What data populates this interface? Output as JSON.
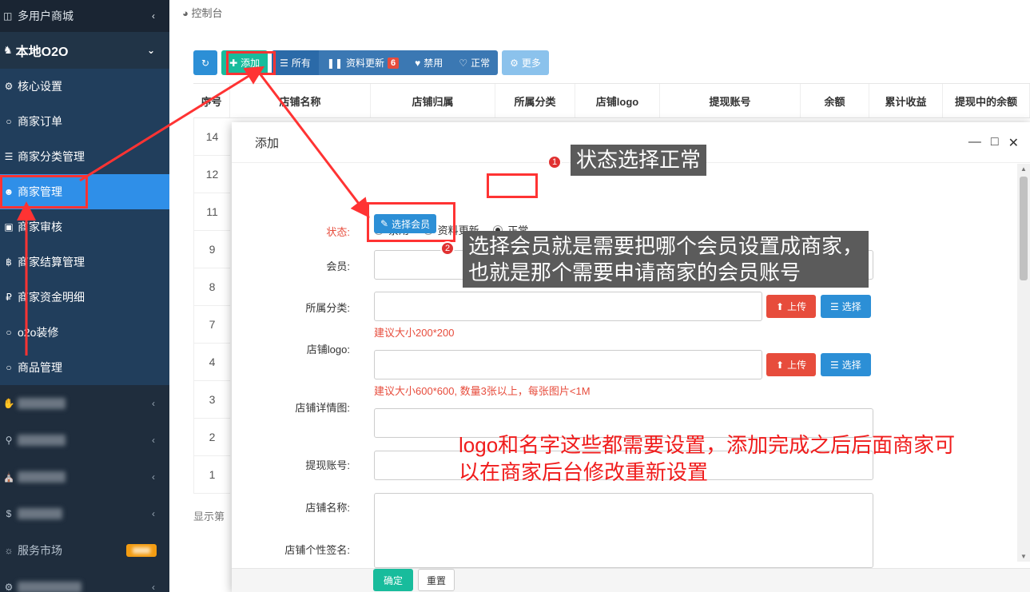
{
  "sidebar": {
    "top": "多用户商城",
    "section": "本地O2O",
    "items": [
      "核心设置",
      "商家订单",
      "商家分类管理",
      "商家管理",
      "商家审核",
      "商家结算管理",
      "商家资金明细",
      "o2o装修",
      "商品管理"
    ],
    "lower_items": [
      "服务市场"
    ]
  },
  "breadcrumb": "控制台",
  "toolbar": {
    "add": "添加",
    "all": "所有",
    "update": "资料更新",
    "update_count": "6",
    "ban": "禁用",
    "normal": "正常",
    "more": "更多"
  },
  "table": {
    "headers": [
      "序号",
      "店铺名称",
      "店铺归属",
      "所属分类",
      "店铺logo",
      "提现账号",
      "余额",
      "累计收益",
      "提现中的余额"
    ],
    "rows": [
      "14",
      "12",
      "11",
      "9",
      "8",
      "7",
      "4",
      "3",
      "2",
      "1"
    ],
    "showing": "显示第"
  },
  "modal": {
    "title": "添加",
    "status_label": "状态:",
    "status_options": [
      "禁用",
      "资料更新",
      "正常"
    ],
    "member_label": "会员:",
    "member_button": "选择会员",
    "category_label": "所属分类:",
    "logo_label": "店铺logo:",
    "logo_hint": "建议大小200*200",
    "detail_label": "店铺详情图:",
    "detail_hint": "建议大小600*600, 数量3张以上，每张图片<1M",
    "upload": "上传",
    "choose": "选择",
    "account_label": "提现账号:",
    "name_label": "店铺名称:",
    "sign_label": "店铺个性签名:",
    "ok": "确定",
    "reset": "重置"
  },
  "annotations": {
    "n1": "1",
    "tip1": "状态选择正常",
    "n2": "2",
    "tip2_line1": "选择会员就是需要把哪个会员设置成商家，",
    "tip2_line2": "也就是那个需要申请商家的会员账号",
    "note_line1": "logo和名字这些都需要设置，添加完成之后后面商家可",
    "note_line2": "以在商家后台修改重新设置"
  }
}
